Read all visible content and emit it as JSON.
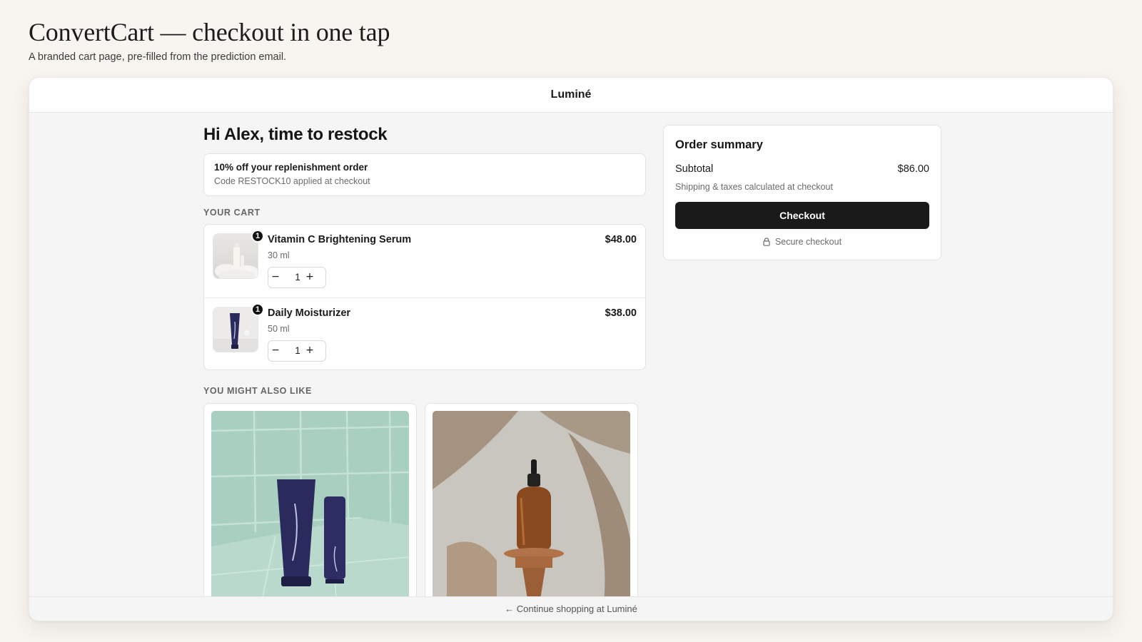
{
  "page": {
    "title": "ConvertCart — checkout in one tap",
    "subtitle": "A branded cart page, pre-filled from the prediction email."
  },
  "store": {
    "name": "Luminé"
  },
  "greeting": "Hi Alex, time to restock",
  "promo": {
    "title": "10% off your replenishment order",
    "subtitle": "Code RESTOCK10 applied at checkout"
  },
  "cart": {
    "label": "YOUR CART",
    "items": [
      {
        "name": "Vitamin C Brightening Serum",
        "size": "30 ml",
        "price": "$48.00",
        "qty": "1",
        "badge": "1",
        "image": "white-serum-bottle"
      },
      {
        "name": "Daily Moisturizer",
        "size": "50 ml",
        "price": "$38.00",
        "qty": "1",
        "badge": "1",
        "image": "navy-moisturizer-tube"
      }
    ],
    "minus_symbol": "−",
    "plus_symbol": "+"
  },
  "recommendations": {
    "label": "YOU MIGHT ALSO LIKE",
    "items": [
      {
        "image": "navy-tube-and-bottle-on-green-tile"
      },
      {
        "image": "amber-dropper-bottle-on-wooden-stand"
      }
    ]
  },
  "summary": {
    "title": "Order summary",
    "subtotal_label": "Subtotal",
    "subtotal_value": "$86.00",
    "note": "Shipping & taxes calculated at checkout",
    "checkout_label": "Checkout",
    "secure_label": "Secure checkout",
    "secure_icon": "lock-icon"
  },
  "footer": {
    "link": "← Continue shopping at Luminé"
  },
  "colors": {
    "page_bg": "#f8f5f1",
    "frame_bg": "#f5f5f5",
    "checkout_button": "#1a1a1a",
    "badge": "#111111"
  }
}
